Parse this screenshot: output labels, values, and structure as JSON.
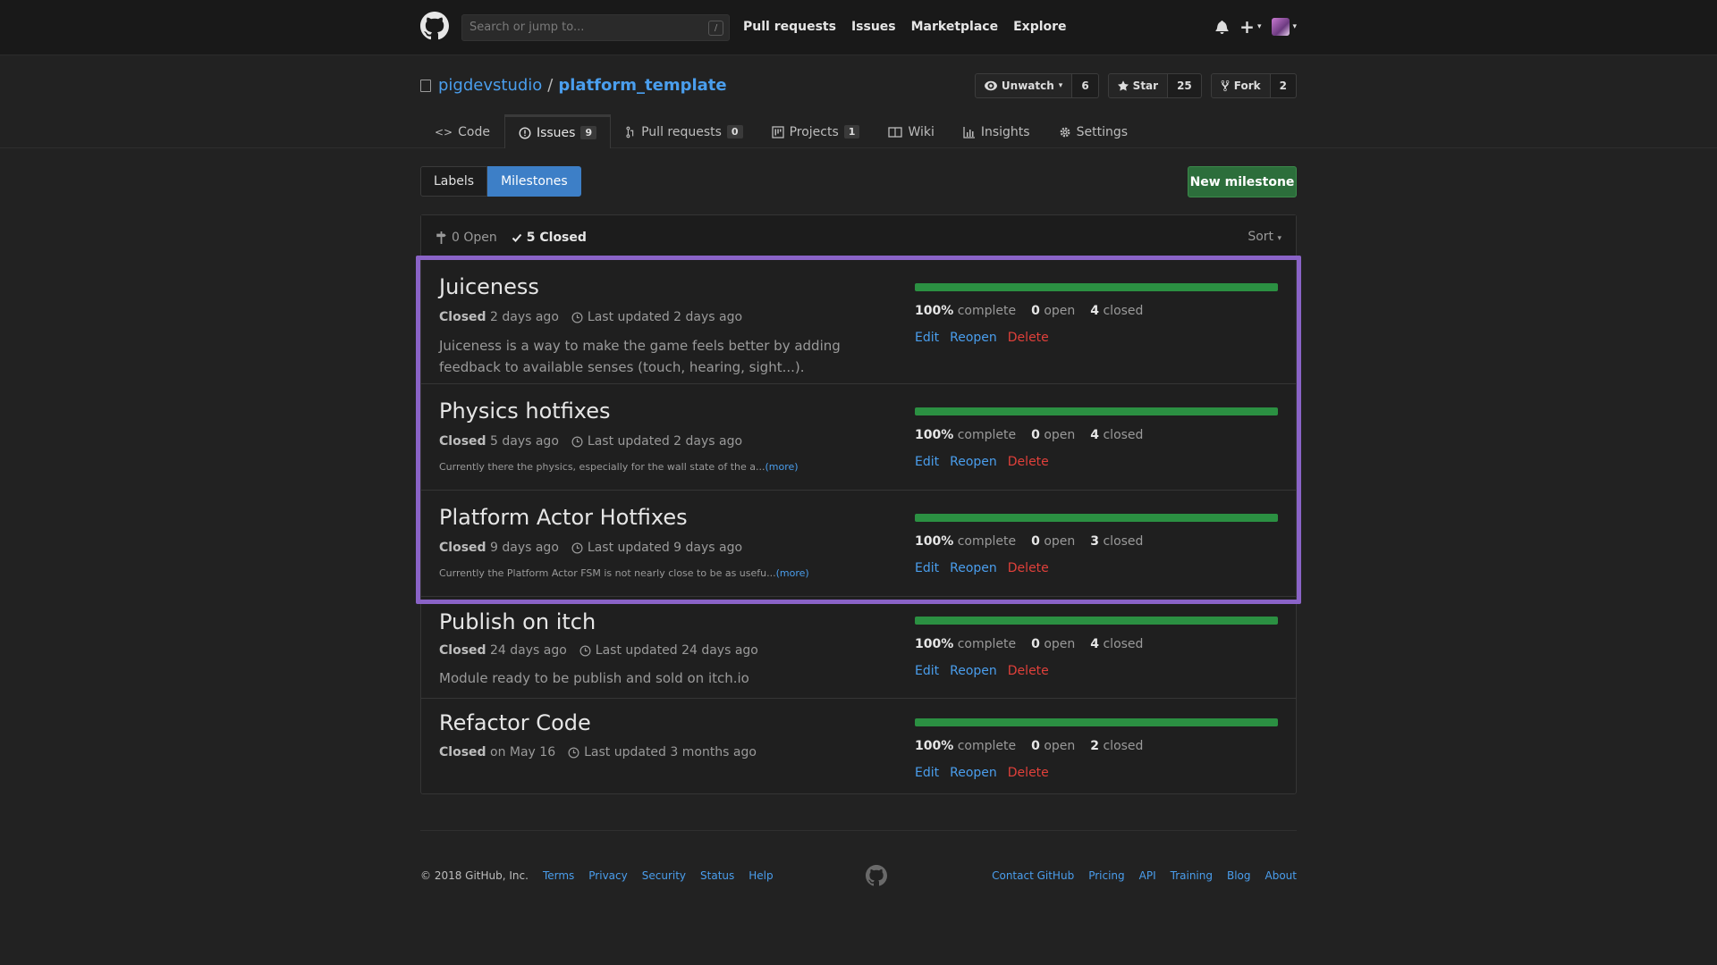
{
  "header": {
    "search_placeholder": "Search or jump to...",
    "slash_key": "/",
    "nav": [
      "Pull requests",
      "Issues",
      "Marketplace",
      "Explore"
    ],
    "plus": "+",
    "caret": "▾"
  },
  "repo": {
    "owner": "pigdevstudio",
    "separator": "/",
    "name": "platform_template",
    "watch_label": "Unwatch",
    "watch_count": "6",
    "star_label": "Star",
    "star_count": "25",
    "fork_label": "Fork",
    "fork_count": "2"
  },
  "tabs": [
    {
      "label": "Code",
      "icon": "code-icon"
    },
    {
      "label": "Issues",
      "count": "9",
      "icon": "issue-icon"
    },
    {
      "label": "Pull requests",
      "count": "0",
      "icon": "pull-request-icon"
    },
    {
      "label": "Projects",
      "count": "1",
      "icon": "project-icon"
    },
    {
      "label": "Wiki",
      "icon": "book-icon"
    },
    {
      "label": "Insights",
      "icon": "graph-icon"
    },
    {
      "label": "Settings",
      "icon": "gear-icon"
    }
  ],
  "subnav": {
    "labels": "Labels",
    "milestones": "Milestones",
    "new_milestone": "New milestone"
  },
  "states": {
    "open": "0 Open",
    "closed": "5 Closed",
    "sort": "Sort"
  },
  "milestone_labels": {
    "closed": "Closed",
    "complete": "complete",
    "open": "open",
    "closed_count": "closed",
    "edit": "Edit",
    "reopen": "Reopen",
    "delete": "Delete",
    "more": "(more)"
  },
  "milestones": [
    {
      "title": "Juiceness",
      "closed_when": "2 days ago",
      "updated": "Last updated 2 days ago",
      "description": "Juiceness is a way to make the game feels better by adding feedback to available senses (touch, hearing, sight...).",
      "percent": "100%",
      "progress": 1.0,
      "open": "0",
      "closed": "4"
    },
    {
      "title": "Physics hotfixes",
      "closed_when": "5 days ago",
      "updated": "Last updated 2 days ago",
      "description": "Currently there the physics, especially for the wall state of the a...",
      "percent": "100%",
      "progress": 1.0,
      "open": "0",
      "closed": "4"
    },
    {
      "title": "Platform Actor Hotfixes",
      "closed_when": "9 days ago",
      "updated": "Last updated 9 days ago",
      "description": "Currently the Platform Actor FSM is not nearly close to be as usefu...",
      "percent": "100%",
      "progress": 1.0,
      "open": "0",
      "closed": "3"
    },
    {
      "title": "Publish on itch",
      "closed_when": "24 days ago",
      "updated": "Last updated 24 days ago",
      "description": "Module ready to be publish and sold on itch.io",
      "percent": "100%",
      "progress": 1.0,
      "open": "0",
      "closed": "4"
    },
    {
      "title": "Refactor Code",
      "closed_when": "on May 16",
      "updated": "Last updated 3 months ago",
      "description": "",
      "percent": "100%",
      "progress": 1.0,
      "open": "0",
      "closed": "2"
    }
  ],
  "footer": {
    "copyright": "© 2018 GitHub, Inc.",
    "left_links": [
      "Terms",
      "Privacy",
      "Security",
      "Status",
      "Help"
    ],
    "right_links": [
      "Contact GitHub",
      "Pricing",
      "API",
      "Training",
      "Blog",
      "About"
    ]
  },
  "colors": {
    "accent_link": "#4a9eed",
    "progress_fill": "#2b9042",
    "delete": "#e0403a",
    "highlight": "#8a63c7",
    "new_milestone": "#2c6e3b"
  }
}
